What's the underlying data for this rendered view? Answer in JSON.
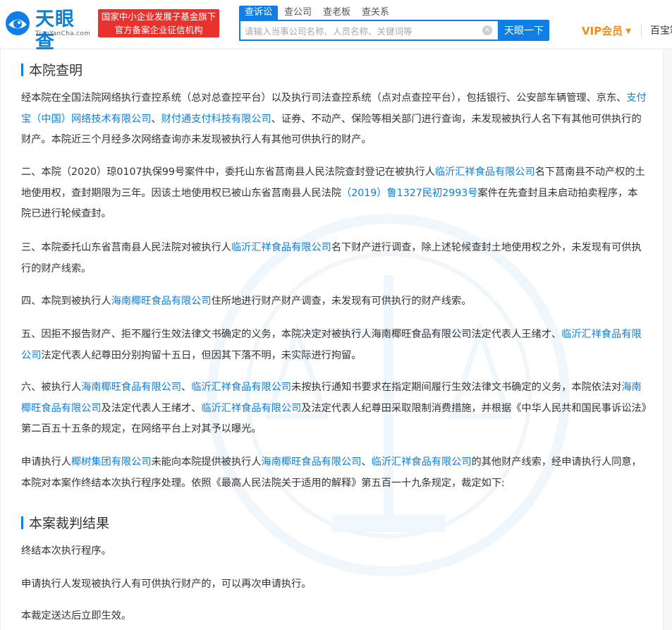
{
  "brand": {
    "name": "天眼查",
    "domain": "TianYanCha.com",
    "badge_line1": "国家中小企业发展子基金旗下",
    "badge_line2": "官方备案企业征信机构"
  },
  "colors": {
    "accent": "#0f7fe6",
    "link": "#0b7ed8",
    "badge": "#e9322d",
    "vip": "#f08c1a"
  },
  "search": {
    "tabs": [
      "查诉讼",
      "查公司",
      "查老板",
      "查关系"
    ],
    "placeholder": "请输入当事公司名称、人员名称、关键词等",
    "button": "天眼一下"
  },
  "header": {
    "vip_label": "VIP会员",
    "more_label": "百宝箱"
  },
  "sections": {
    "finding_title": "本院查明",
    "result_title": "本案裁判结果"
  },
  "p1": {
    "t1": "经本院在全国法院网络执行查控系统（总对总查控平台）以及执行司法查控系统（点对点查控平台），包括银行、公安部车辆管理、京东、",
    "l1": "支付宝（中国）网络技术有限公司",
    "t2": "、",
    "l2": "财付通支付科技有限公司",
    "t3": "、证券、不动产、保险等相关部门进行查询，未发现被执行人名下有其他可供执行的财产。本院近三个月经多次网络查询亦未发现被执行人有其他可供执行的财产。"
  },
  "p2": {
    "t1": "二、本院（2020）琼0107执保99号案件中，委托山东省莒南县人民法院查封登记在被执行人",
    "l1": "临沂汇祥食品有限公司",
    "t2": "名下莒南县不动产权的土地使用权，查封期限为三年。因该土地使用权已被山东省莒南县人民法院",
    "l2": "（2019）鲁1327民初2993号",
    "t3": "案件在先查封且未启动拍卖程序，本院已进行轮候查封。"
  },
  "p3": {
    "t1": "三、本院委托山东省莒南县人民法院对被执行人",
    "l1": "临沂汇祥食品有限公司",
    "t2": "名下财产进行调查，除上述轮候查封土地使用权之外，未发现有可供执行的财产线索。"
  },
  "p4": {
    "t1": "四、本院到被执行人",
    "l1": "海南椰旺食品有限公司",
    "t2": "住所地进行财产财产调查，未发现有可供执行的财产线索。"
  },
  "p5": {
    "t1": "五、因拒不报告财产、拒不履行生效法律文书确定的义务，本院决定对被执行人海南椰旺食品有限公司法定代表人王绪才、",
    "l1": "临沂汇祥食品有限公司",
    "t2": "法定代表人纪尊田分别拘留十五日，但因其下落不明，未实际进行拘留。"
  },
  "p6": {
    "t1": "六、被执行人",
    "l1": "海南椰旺食品有限公司",
    "t2": "、",
    "l2": "临沂汇祥食品有限公司",
    "t3": "未按执行通知书要求在指定期间履行生效法律文书确定的义务，本院依法对",
    "l3": "海南椰旺食品有限公司",
    "t4": "及法定代表人王绪才、",
    "l4": "临沂汇祥食品有限公司",
    "t5": "及法定代表人纪尊田采取限制消费措施，并根据《中华人民共和国民事诉讼法》第二百五十五条的规定，在网络平台上对其予以曝光。"
  },
  "p7": {
    "t1": "申请执行人",
    "l1": "椰树集团有限公司",
    "t2": "未能向本院提供被执行人",
    "l2": "海南椰旺食品有限公司",
    "t3": "、",
    "l3": "临沂汇祥食品有限公司",
    "t4": "的其他财产线索，经申请执行人同意，本院对本案作终结本次执行程序处理。依照《最高人民法院关于适用的解释》第五百一十九条规定，裁定如下:"
  },
  "result": {
    "r1": "终结本次执行程序。",
    "r2": "申请执行人发现被执行人有可供执行财产的，可以再次申请执行。",
    "r3": "本裁定送达后立即生效。"
  }
}
